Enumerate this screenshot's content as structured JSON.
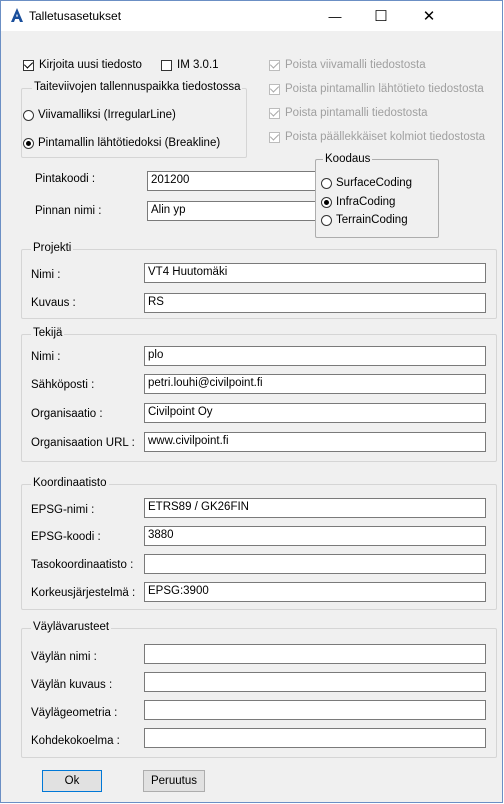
{
  "window": {
    "title": "Talletusasetukset",
    "minimize": "—",
    "maximize": "☐",
    "close": "✕"
  },
  "top_options": {
    "write_new_file": {
      "label": "Kirjoita uusi tiedosto",
      "checked": true
    },
    "im301": {
      "label": "IM 3.0.1",
      "checked": false
    }
  },
  "breakline_group": {
    "title": "Taiteviivojen tallennuspaikka tiedostossa",
    "options": [
      {
        "label": "Viivamalliksi (IrregularLine)",
        "selected": false
      },
      {
        "label": "Pintamallin lähtötiedoksi (Breakline)",
        "selected": true
      }
    ]
  },
  "remove_options": [
    {
      "label": "Poista viivamalli tiedostosta",
      "checked": true
    },
    {
      "label": "Poista pintamallin lähtötieto tiedostosta",
      "checked": true
    },
    {
      "label": "Poista pintamalli tiedostosta",
      "checked": true
    },
    {
      "label": "Poista päällekkäiset kolmiot tiedostosta",
      "checked": true
    }
  ],
  "surface": {
    "code_label": "Pintakoodi :",
    "code_value": "201200",
    "name_label": "Pinnan nimi :",
    "name_value": "Alin yp"
  },
  "coding_group": {
    "title": "Koodaus",
    "options": [
      {
        "label": "SurfaceCoding",
        "selected": false
      },
      {
        "label": "InfraCoding",
        "selected": true
      },
      {
        "label": "TerrainCoding",
        "selected": false
      }
    ]
  },
  "project": {
    "title": "Projekti",
    "name_label": "Nimi :",
    "name_value": "VT4 Huutomäki",
    "desc_label": "Kuvaus :",
    "desc_value": "RS"
  },
  "author": {
    "title": "Tekijä",
    "name_label": "Nimi :",
    "name_value": "plo",
    "email_label": "Sähköposti :",
    "email_value": "petri.louhi@civilpoint.fi",
    "org_label": "Organisaatio :",
    "org_value": "Civilpoint Oy",
    "url_label": "Organisaation URL :",
    "url_value": "www.civilpoint.fi"
  },
  "coords": {
    "title": "Koordinaatisto",
    "epsg_name_label": "EPSG-nimi :",
    "epsg_name_value": "ETRS89 / GK26FIN",
    "epsg_code_label": "EPSG-koodi :",
    "epsg_code_value": "3880",
    "plane_label": "Tasokoordinaatisto :",
    "plane_value": "",
    "height_label": "Korkeusjärjestelmä :",
    "height_value": "EPSG:3900"
  },
  "fairway": {
    "title": "Väylävarusteet",
    "name_label": "Väylän nimi :",
    "name_value": "",
    "desc_label": "Väylän kuvaus :",
    "desc_value": "",
    "geom_label": "Väylägeometria :",
    "geom_value": "",
    "collection_label": "Kohdekokoelma :",
    "collection_value": ""
  },
  "buttons": {
    "ok": "Ok",
    "cancel": "Peruutus"
  },
  "colors": {
    "accent": "#0078d7",
    "title_icon": "#1a4f9c"
  }
}
